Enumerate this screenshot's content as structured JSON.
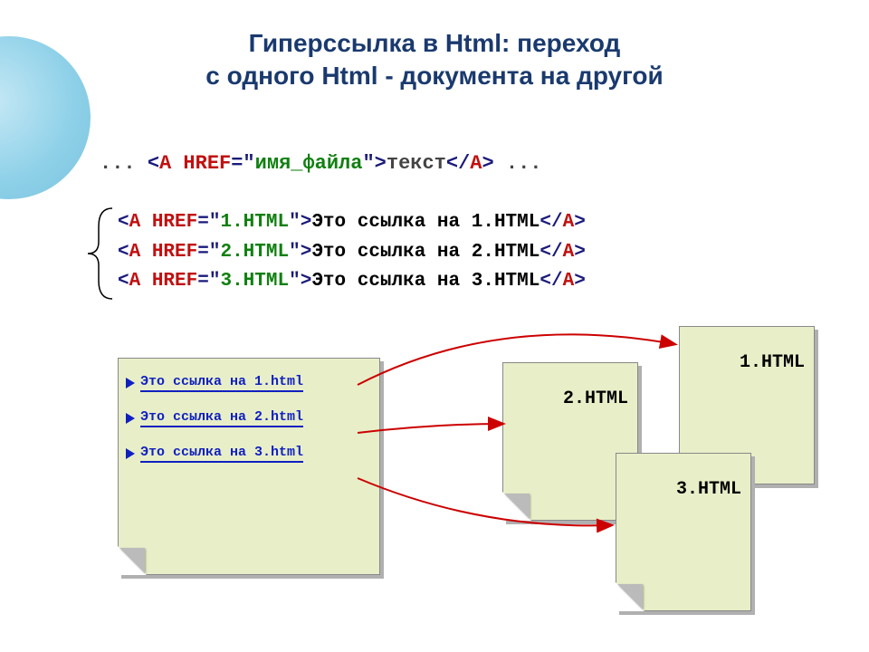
{
  "title_line1": "Гиперссылка  в Html:  переход",
  "title_line2": "с одного Html - документа на другой",
  "syntax": {
    "prefix": "... ",
    "open1": "<",
    "tag_a": "A",
    "sp1": " ",
    "href": "HREF",
    "eq": "=\"",
    "file_label": "имя_файла",
    "close1": "\">",
    "linktext": "текст",
    "open2": "</",
    "tag_a2": "A",
    "close2": ">",
    "suffix": " ..."
  },
  "examples": [
    {
      "file": "1.HTML",
      "text": "Это ссылка на 1.HTML"
    },
    {
      "file": "2.HTML",
      "text": "Это ссылка на 2.HTML"
    },
    {
      "file": "3.HTML",
      "text": "Это ссылка на 3.HTML"
    }
  ],
  "source_doc_links": [
    "Это ссылка на 1.html",
    "Это ссылка на 2.html",
    "Это ссылка на 3.html"
  ],
  "target_docs": {
    "d1": "1.HTML",
    "d2": "2.HTML",
    "d3": "3.HTML"
  }
}
